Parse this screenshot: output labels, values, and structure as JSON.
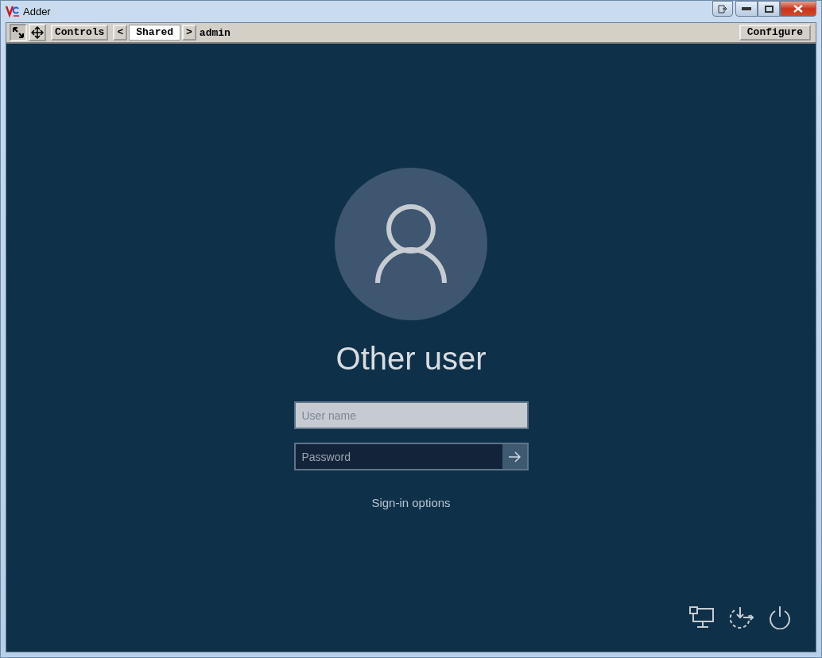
{
  "window": {
    "title": "Adder"
  },
  "toolbar": {
    "controls_button": "Controls",
    "prev": "<",
    "channel": "Shared",
    "next": ">",
    "user": "admin",
    "configure_button": "Configure"
  },
  "login": {
    "user_name": "Other user",
    "username_placeholder": "User name",
    "password_placeholder": "Password",
    "sign_in_options": "Sign-in options"
  }
}
